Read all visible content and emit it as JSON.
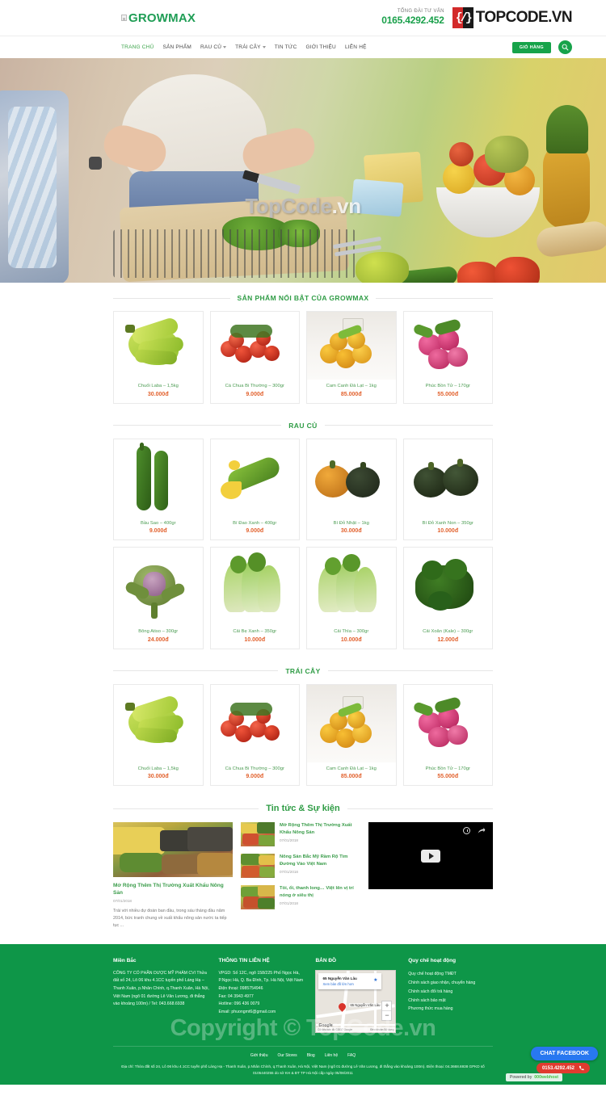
{
  "header": {
    "logo_alt": "GROWMAX",
    "hotline_label": "TỔNG ĐÀI TƯ VẤN",
    "hotline_number": "0165.4292.452",
    "partner_logo_mark": "{/}",
    "partner_logo_top": "TOP",
    "partner_logo_code": "CODE",
    "partner_logo_tld": ".VN",
    "nav": [
      {
        "label": "TRANG CHỦ",
        "dropdown": false,
        "active": true
      },
      {
        "label": "SẢN PHẨM",
        "dropdown": false,
        "active": false
      },
      {
        "label": "RAU CỦ",
        "dropdown": true,
        "active": false
      },
      {
        "label": "TRÁI CÂY",
        "dropdown": true,
        "active": false
      },
      {
        "label": "TIN TỨC",
        "dropdown": false,
        "active": false
      },
      {
        "label": "GIỚI THIỆU",
        "dropdown": false,
        "active": false
      },
      {
        "label": "LIÊN HỆ",
        "dropdown": false,
        "active": false
      }
    ],
    "cart_label": "GIỎ HÀNG",
    "search_icon": "search-icon"
  },
  "hero": {
    "watermark_part1": "TopCode",
    "watermark_part2": ".vn"
  },
  "sections": {
    "featured_title": "SẢN PHẨM NỔI BẬT CỦA GROWMAX",
    "vegetables_title": "RAU CỦ",
    "fruits_title": "TRÁI CÂY",
    "news_title": "Tin tức & Sự kiện"
  },
  "featured_products": [
    {
      "name": "Chuối Laba – 1,5kg",
      "price": "30.000đ",
      "art": "banana"
    },
    {
      "name": "Cà Chua Bi Thường – 300gr",
      "price": "9.000đ",
      "art": "tomato"
    },
    {
      "name": "Cam Canh Đà Lạt – 1kg",
      "price": "85.000đ",
      "art": "orange"
    },
    {
      "name": "Phúc Bồn Tử – 170gr",
      "price": "55.000đ",
      "art": "raspberry"
    }
  ],
  "vegetable_products_row1": [
    {
      "name": "Bầu Sao – 400gr",
      "price": "9.000đ",
      "art": "gourd"
    },
    {
      "name": "Bí Đao Xanh – 400gr",
      "price": "9.000đ",
      "art": "zucchini"
    },
    {
      "name": "Bí Đỏ Nhật – 1kg",
      "price": "30.000đ",
      "art": "pumpkin"
    },
    {
      "name": "Bí Đỏ Xanh Non – 350gr",
      "price": "10.000đ",
      "art": "greenpumpkin"
    }
  ],
  "vegetable_products_row2": [
    {
      "name": "Bông Atiso – 300gr",
      "price": "24.000đ",
      "art": "artichoke"
    },
    {
      "name": "Cải Bẹ Xanh – 350gr",
      "price": "10.000đ",
      "art": "bokchoy"
    },
    {
      "name": "Cải Thìa – 300gr",
      "price": "10.000đ",
      "art": "bokchoy2"
    },
    {
      "name": "Cải Xoăn (Kale) – 300gr",
      "price": "12.000đ",
      "art": "kale"
    }
  ],
  "fruit_products": [
    {
      "name": "Chuối Laba – 1,5kg",
      "price": "30.000đ",
      "art": "banana"
    },
    {
      "name": "Cà Chua Bi Thường – 300gr",
      "price": "9.000đ",
      "art": "tomato"
    },
    {
      "name": "Cam Canh Đà Lạt – 1kg",
      "price": "85.000đ",
      "art": "orange"
    },
    {
      "name": "Phúc Bồn Tử – 170gr",
      "price": "55.000đ",
      "art": "raspberry"
    }
  ],
  "news": {
    "main": {
      "title": "Mở Rộng Thêm Thị Trường Xuất Khẩu Nông Sản",
      "date": "07/01/2018",
      "excerpt": "Trái với nhiều dự đoán ban đầu, trong sáu tháng đầu năm 2014, bức tranh chung về xuất khẩu nông sản nước ta tiếp tục ..."
    },
    "items": [
      {
        "title": "Mở Rộng Thêm Thị Trường Xuất Khẩu Nông Sản",
        "date": "07/01/2018"
      },
      {
        "title": "Nông Sản Bắc Mỹ Rầm Rộ Tìm Đường Vào Việt Nam",
        "date": "07/01/2018"
      },
      {
        "title": "Tỏi, ổi, thanh long… Việt lên vị trí nóng ở siêu thị",
        "date": "07/01/2018"
      }
    ]
  },
  "footer": {
    "col1": {
      "heading": "Miền Bắc",
      "body": "CÔNG TY CỔ PHẦN DƯỢC MỸ PHẨM CVI\nThửa đất số 24, Lô 06 khu 4.1CC tuyến phố Láng Hạ – Thanh Xuân, p.Nhân Chính, q.Thanh Xuân, Hà Nội, Việt Nam (ngõ 01 đường Lê Văn Lương, đi thẳng vào khoảng 100m) / Tel: 043.668.6938"
    },
    "col2": {
      "heading": "THÔNG  TIN LIÊN HỆ",
      "address": "VPGD: Số 12C, ngõ 158/225 Phố Ngọc Hà, P.Ngọc Hà, Q. Ba Đình, Tp. Hà Nội, Việt Nam",
      "phone": "Điện thoại: 0985754946",
      "fax": "Fax: 04 3943 4977",
      "hotline": "Hotline: 096 436 0079",
      "email": "Email: phuongmt6@gmail.com"
    },
    "col3": {
      "heading": "BẢN ĐỒ"
    },
    "col4": {
      "heading": "Quy chế hoạt động",
      "links": [
        "Quy chế hoạt động TMĐT",
        "Chính sách giao nhận, chuyển hàng",
        "Chính sách đổi trả hàng",
        "Chính sách bảo mật",
        "Phương thức mua hàng"
      ]
    },
    "map": {
      "card_title": "65 Nguyễn Văn Lâu",
      "card_link": "Xem bản đồ lớn hơn",
      "pin_label": "65 Nguyễn Văn Lâu",
      "zoom_in": "+",
      "zoom_out": "−",
      "logo": "Google",
      "attrib_left": "Dữ liệu bản đồ ©2017 Google",
      "attrib_right": "Điều khoản Sử dụng"
    },
    "watermark": "Copyright © TopCode.vn",
    "bottom_links": [
      "Giới thiệu",
      "Our Stores",
      "Blog",
      "Liên hệ",
      "FAQ"
    ],
    "bottom_address": "Địa chỉ: Thửa đất số 24, Lô 06 khu 4.1CC tuyến phố Láng Hạ - Thanh Xuân, p.Nhân Chính, q.Thanh Xuân, Hà Nội, Việt Nam (ngõ 01 đường Lê Văn Lương, đi thẳng vào khoảng 100m). Điện thoại: 04.3668.6938 GPKD số 0105440255 do sở KH & ĐT TP Hà Nội cấp ngày 05/08/2011"
  },
  "widgets": {
    "chat_label": "CHAT FACEBOOK",
    "phone_number": "0153.4292.452",
    "phone_icon": "phone-icon",
    "powered_prefix": "Powered by",
    "powered_brand": "000webhost"
  }
}
